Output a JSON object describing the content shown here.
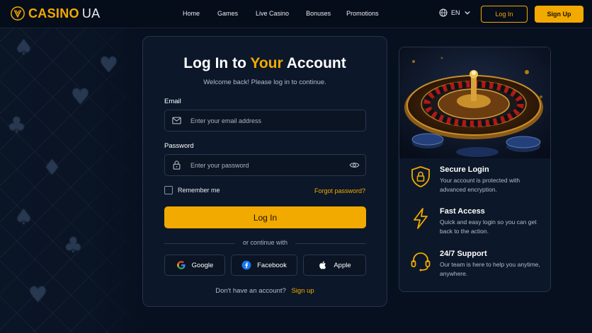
{
  "header": {
    "logo_text": "CASINO",
    "logo_suffix": "UA",
    "nav": [
      "Home",
      "Games",
      "Live Casino",
      "Bonuses",
      "Promotions"
    ],
    "language": "EN",
    "login_label": "Log In",
    "signup_label": "Sign Up"
  },
  "login": {
    "title_part1": "Log In to",
    "title_accent": "Your",
    "title_part2": "Account",
    "subtitle": "Welcome back! Please log in to continue.",
    "email_label": "Email",
    "email_placeholder": "Enter your email address",
    "email_value": "",
    "password_label": "Password",
    "password_placeholder": "Enter your password",
    "password_value": "",
    "remember_label": "Remember me",
    "remember_checked": false,
    "forgot_label": "Forgot password?",
    "submit_label": "Log In",
    "divider_text": "or continue with",
    "social": [
      "Google",
      "Facebook",
      "Apple"
    ],
    "no_account_text": "Don't have an account?",
    "signup_link": "Sign up"
  },
  "features": [
    {
      "icon": "shield-lock-icon",
      "title": "Secure Login",
      "desc": "Your account is protected with advanced encryption."
    },
    {
      "icon": "lightning-icon",
      "title": "Fast Access",
      "desc": "Quick and easy login so you can get back to the action."
    },
    {
      "icon": "headset-icon",
      "title": "24/7 Support",
      "desc": "Our team is here to help you anytime, anywhere."
    }
  ],
  "colors": {
    "accent": "#f2a900",
    "background": "#07101f",
    "card": "#0c1829"
  }
}
